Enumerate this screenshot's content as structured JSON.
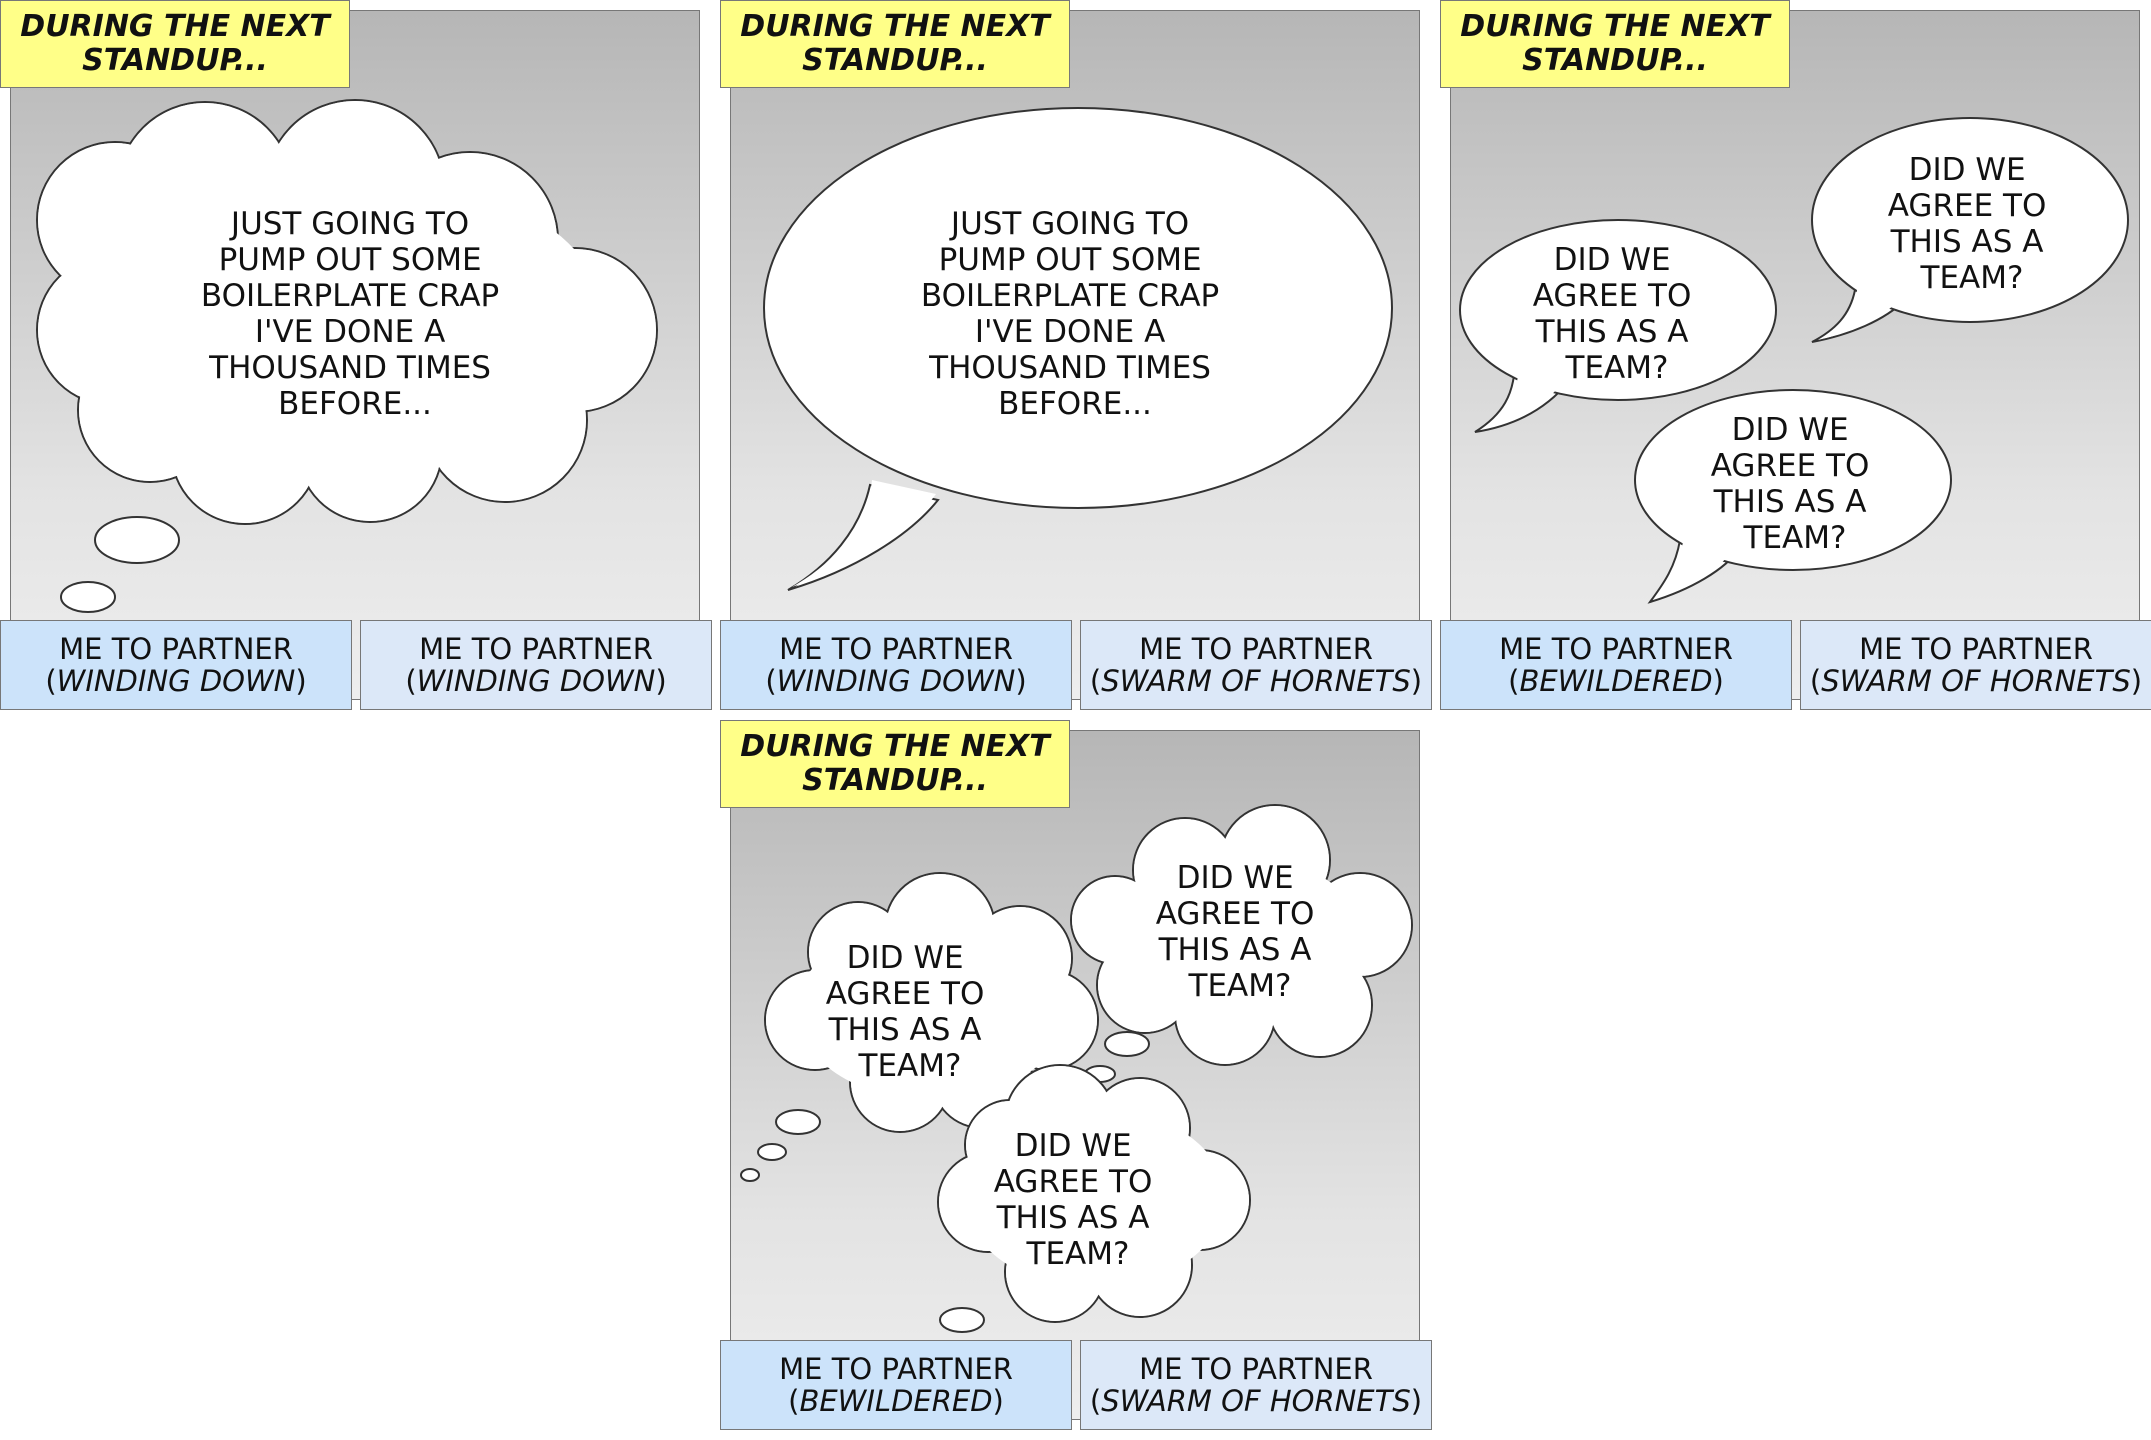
{
  "panels": [
    {
      "caption": "DURING THE NEXT\nSTANDUP...",
      "bubbles": [
        {
          "kind": "thought",
          "text": [
            "JUST GOING TO",
            "PUMP OUT SOME",
            "BOILERPLATE CRAP",
            "I'VE DONE A",
            "THOUSAND TIMES",
            "BEFORE..."
          ]
        }
      ],
      "labels": [
        {
          "name": "ME TO PARTNER",
          "mood": "WINDING DOWN"
        },
        {
          "name": "ME TO PARTNER",
          "mood": "WINDING DOWN"
        }
      ]
    },
    {
      "caption": "DURING THE NEXT\nSTANDUP...",
      "bubbles": [
        {
          "kind": "speech",
          "text": [
            "JUST GOING TO",
            "PUMP OUT SOME",
            "BOILERPLATE CRAP",
            "I'VE DONE A",
            "THOUSAND TIMES",
            "BEFORE..."
          ]
        }
      ],
      "labels": [
        {
          "name": "ME TO PARTNER",
          "mood": "WINDING DOWN"
        },
        {
          "name": "ME TO PARTNER",
          "mood": "SWARM OF HORNETS"
        }
      ]
    },
    {
      "caption": "DURING THE NEXT\nSTANDUP...",
      "bubbles": [
        {
          "kind": "speech",
          "text": [
            "DID WE",
            "AGREE TO",
            "THIS AS A",
            "TEAM?"
          ]
        },
        {
          "kind": "speech",
          "text": [
            "DID WE",
            "AGREE TO",
            "THIS AS A",
            "TEAM?"
          ]
        },
        {
          "kind": "speech",
          "text": [
            "DID WE",
            "AGREE TO",
            "THIS AS A",
            "TEAM?"
          ]
        }
      ],
      "labels": [
        {
          "name": "ME TO PARTNER",
          "mood": "BEWILDERED"
        },
        {
          "name": "ME TO PARTNER",
          "mood": "SWARM OF HORNETS"
        }
      ]
    },
    {
      "caption": "DURING THE NEXT\nSTANDUP...",
      "bubbles": [
        {
          "kind": "thought",
          "text": [
            "DID WE",
            "AGREE TO",
            "THIS AS A",
            "TEAM?"
          ]
        },
        {
          "kind": "thought",
          "text": [
            "DID WE",
            "AGREE TO",
            "THIS AS A",
            "TEAM?"
          ]
        },
        {
          "kind": "thought",
          "text": [
            "DID WE",
            "AGREE TO",
            "THIS AS A",
            "TEAM?"
          ]
        }
      ],
      "labels": [
        {
          "name": "ME TO PARTNER",
          "mood": "BEWILDERED"
        },
        {
          "name": "ME TO PARTNER",
          "mood": "SWARM OF HORNETS"
        }
      ]
    }
  ]
}
